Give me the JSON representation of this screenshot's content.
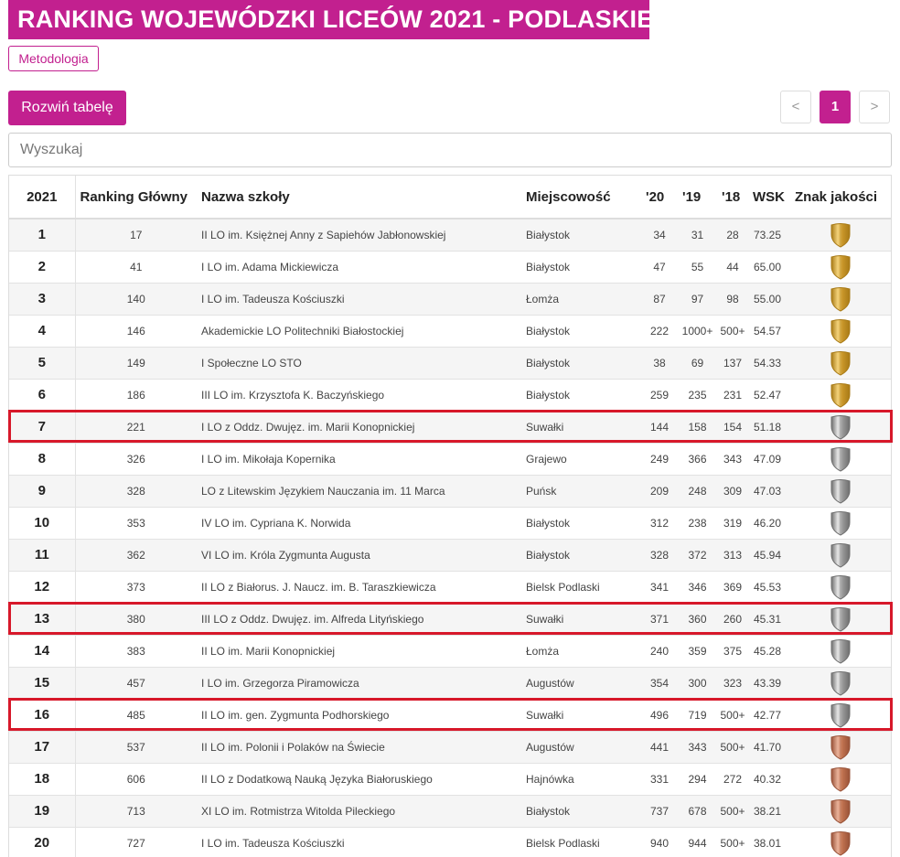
{
  "page": {
    "title": "RANKING WOJEWÓDZKI LICEÓW 2021 - PODLASKIE",
    "methodology_label": "Metodologia",
    "expand_label": "Rozwiń tabelę",
    "search_placeholder": "Wyszukaj",
    "pager": {
      "prev": "<",
      "current": "1",
      "next": ">"
    },
    "accent_color": "#c2208f",
    "highlight_color": "#d7182a"
  },
  "table": {
    "headers": [
      "2021",
      "Ranking Główny",
      "Nazwa szkoły",
      "Miejscowość",
      "'20",
      "'19",
      "'18",
      "WSK",
      "Znak jakości"
    ],
    "rows": [
      {
        "rank": "1",
        "rg": "17",
        "name": "II LO im. Księżnej Anny z Sapiehów Jabłonowskiej",
        "city": "Białystok",
        "y20": "34",
        "y19": "31",
        "y18": "28",
        "wsk": "73.25",
        "badge": "gold"
      },
      {
        "rank": "2",
        "rg": "41",
        "name": "I LO im. Adama Mickiewicza",
        "city": "Białystok",
        "y20": "47",
        "y19": "55",
        "y18": "44",
        "wsk": "65.00",
        "badge": "gold"
      },
      {
        "rank": "3",
        "rg": "140",
        "name": "I LO im. Tadeusza Kościuszki",
        "city": "Łomża",
        "y20": "87",
        "y19": "97",
        "y18": "98",
        "wsk": "55.00",
        "badge": "gold"
      },
      {
        "rank": "4",
        "rg": "146",
        "name": "Akademickie LO Politechniki Białostockiej",
        "city": "Białystok",
        "y20": "222",
        "y19": "1000+",
        "y18": "500+",
        "wsk": "54.57",
        "badge": "gold"
      },
      {
        "rank": "5",
        "rg": "149",
        "name": "I Społeczne LO STO",
        "city": "Białystok",
        "y20": "38",
        "y19": "69",
        "y18": "137",
        "wsk": "54.33",
        "badge": "gold"
      },
      {
        "rank": "6",
        "rg": "186",
        "name": "III LO im. Krzysztofa K. Baczyńskiego",
        "city": "Białystok",
        "y20": "259",
        "y19": "235",
        "y18": "231",
        "wsk": "52.47",
        "badge": "gold"
      },
      {
        "rank": "7",
        "rg": "221",
        "name": "I LO z Oddz. Dwujęz. im. Marii Konopnickiej",
        "city": "Suwałki",
        "y20": "144",
        "y19": "158",
        "y18": "154",
        "wsk": "51.18",
        "badge": "silver"
      },
      {
        "rank": "8",
        "rg": "326",
        "name": "I LO im. Mikołaja Kopernika",
        "city": "Grajewo",
        "y20": "249",
        "y19": "366",
        "y18": "343",
        "wsk": "47.09",
        "badge": "silver"
      },
      {
        "rank": "9",
        "rg": "328",
        "name": "LO z Litewskim Językiem Nauczania im. 11 Marca",
        "city": "Puńsk",
        "y20": "209",
        "y19": "248",
        "y18": "309",
        "wsk": "47.03",
        "badge": "silver"
      },
      {
        "rank": "10",
        "rg": "353",
        "name": "IV LO im. Cypriana K. Norwida",
        "city": "Białystok",
        "y20": "312",
        "y19": "238",
        "y18": "319",
        "wsk": "46.20",
        "badge": "silver"
      },
      {
        "rank": "11",
        "rg": "362",
        "name": "VI LO im. Króla Zygmunta Augusta",
        "city": "Białystok",
        "y20": "328",
        "y19": "372",
        "y18": "313",
        "wsk": "45.94",
        "badge": "silver"
      },
      {
        "rank": "12",
        "rg": "373",
        "name": "II LO z Białorus. J. Naucz. im. B. Taraszkiewicza",
        "city": "Bielsk Podlaski",
        "y20": "341",
        "y19": "346",
        "y18": "369",
        "wsk": "45.53",
        "badge": "silver"
      },
      {
        "rank": "13",
        "rg": "380",
        "name": "III LO z Oddz. Dwujęz. im. Alfreda Lityńskiego",
        "city": "Suwałki",
        "y20": "371",
        "y19": "360",
        "y18": "260",
        "wsk": "45.31",
        "badge": "silver"
      },
      {
        "rank": "14",
        "rg": "383",
        "name": "II LO im. Marii Konopnickiej",
        "city": "Łomża",
        "y20": "240",
        "y19": "359",
        "y18": "375",
        "wsk": "45.28",
        "badge": "silver"
      },
      {
        "rank": "15",
        "rg": "457",
        "name": "I LO im. Grzegorza Piramowicza",
        "city": "Augustów",
        "y20": "354",
        "y19": "300",
        "y18": "323",
        "wsk": "43.39",
        "badge": "silver"
      },
      {
        "rank": "16",
        "rg": "485",
        "name": "II LO im. gen. Zygmunta Podhorskiego",
        "city": "Suwałki",
        "y20": "496",
        "y19": "719",
        "y18": "500+",
        "wsk": "42.77",
        "badge": "silver"
      },
      {
        "rank": "17",
        "rg": "537",
        "name": "II LO im. Polonii i Polaków na Świecie",
        "city": "Augustów",
        "y20": "441",
        "y19": "343",
        "y18": "500+",
        "wsk": "41.70",
        "badge": "bronze"
      },
      {
        "rank": "18",
        "rg": "606",
        "name": "II LO z Dodatkową Nauką Języka Białoruskiego",
        "city": "Hajnówka",
        "y20": "331",
        "y19": "294",
        "y18": "272",
        "wsk": "40.32",
        "badge": "bronze"
      },
      {
        "rank": "19",
        "rg": "713",
        "name": "XI LO im. Rotmistrza Witolda Pileckiego",
        "city": "Białystok",
        "y20": "737",
        "y19": "678",
        "y18": "500+",
        "wsk": "38.21",
        "badge": "bronze"
      },
      {
        "rank": "20",
        "rg": "727",
        "name": "I LO im. Tadeusza Kościuszki",
        "city": "Bielsk Podlaski",
        "y20": "940",
        "y19": "944",
        "y18": "500+",
        "wsk": "38.01",
        "badge": "bronze"
      }
    ],
    "highlighted_ranks": [
      "7",
      "13",
      "16"
    ]
  }
}
